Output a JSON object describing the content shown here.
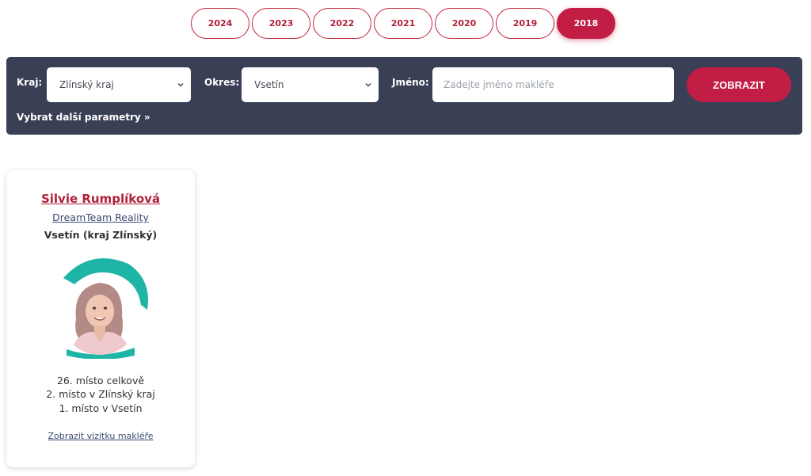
{
  "years": [
    "2024",
    "2023",
    "2022",
    "2021",
    "2020",
    "2019",
    "2018"
  ],
  "active_year": "2018",
  "filter": {
    "region_label": "Kraj:",
    "region_value": "Zlínský kraj",
    "district_label": "Okres:",
    "district_value": "Vsetín",
    "name_label": "Jméno:",
    "name_placeholder": "Zadejte jméno makléře",
    "submit_label": "ZOBRAZIT",
    "more_params_label": "Vybrat další parametry »"
  },
  "agent": {
    "name": "Silvie Rumplíková",
    "agency": "DreamTeam Reality",
    "location": "Vsetín (kraj Zlínský)",
    "rank_overall": "26. místo celkově",
    "rank_region": "2. místo v Zlínský kraj",
    "rank_district": "1. místo v Vsetín",
    "profile_link": "Zobrazit vizitku makléře"
  },
  "colors": {
    "accent": "#c21d44",
    "bar": "#393f55",
    "teal": "#1eb5a6"
  },
  "icons": {
    "select_chevron": "chevron-down-icon"
  }
}
